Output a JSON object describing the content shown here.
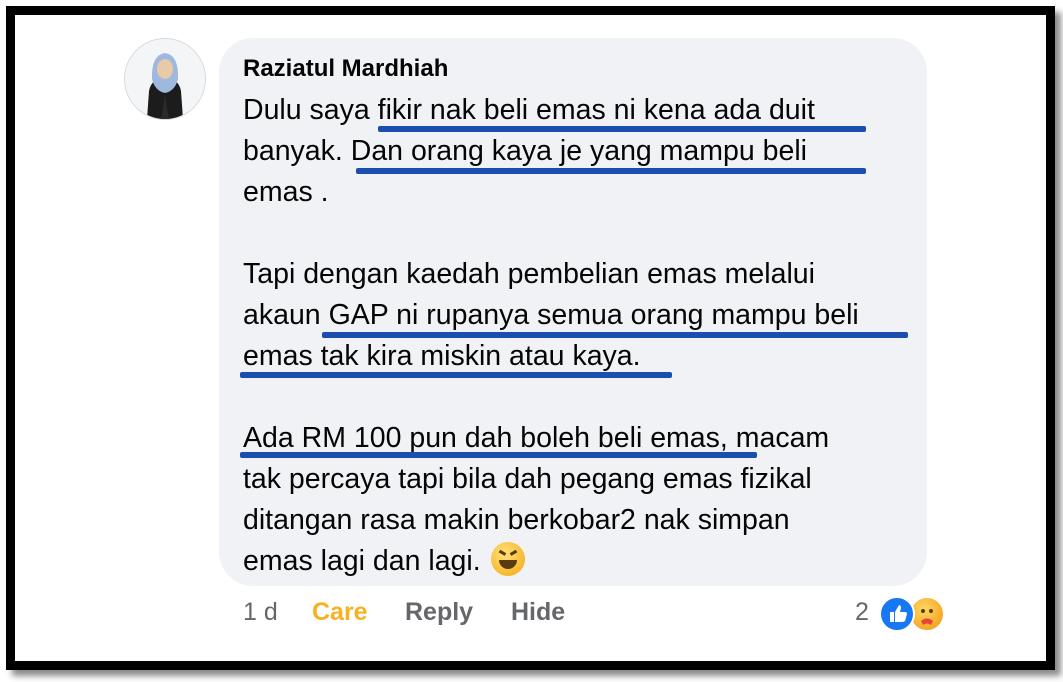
{
  "comment": {
    "author": "Raziatul Mardhiah",
    "paragraphs": [
      [
        "Dulu saya fikir nak beli emas ni kena ada duit",
        "banyak. Dan orang kaya je yang mampu beli",
        "emas ."
      ],
      [
        "Tapi dengan kaedah pembelian emas melalui",
        "akaun GAP ni rupanya semua orang mampu beli",
        "emas tak kira miskin atau kaya."
      ],
      [
        "Ada RM 100 pun dah boleh beli emas, macam",
        "tak percaya tapi bila dah pegang emas fizikal",
        "ditangan rasa makin berkobar2 nak simpan",
        "emas lagi dan lagi."
      ]
    ],
    "emoji": "grinning-squinting-face",
    "highlight_color": "#1a4fb0"
  },
  "actions": {
    "time": "1 d",
    "care": "Care",
    "reply": "Reply",
    "hide": "Hide"
  },
  "reactions": {
    "count": "2",
    "icons": [
      "like-icon",
      "care-icon"
    ]
  },
  "colors": {
    "bubble": "#f0f2f5",
    "care_text": "#f7b125",
    "like_blue": "#1877f2",
    "muted_text": "#65676b"
  }
}
